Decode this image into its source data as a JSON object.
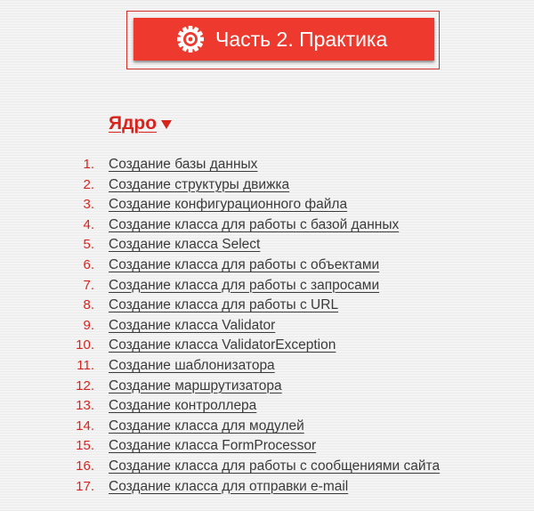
{
  "header": {
    "button_label": "Часть 2. Практика",
    "icon": "gear-icon",
    "colors": {
      "banner": "#ee3a2e",
      "accent": "#d8231c"
    }
  },
  "section": {
    "title": "Ядро",
    "toggle_icon": "triangle-down-icon"
  },
  "lessons": [
    {
      "number": "1.",
      "title": "Создание базы данных"
    },
    {
      "number": "2.",
      "title": "Создание структуры движка"
    },
    {
      "number": "3.",
      "title": "Создание конфигурационного файла"
    },
    {
      "number": "4.",
      "title": "Создание класса для работы с базой данных"
    },
    {
      "number": "5.",
      "title": "Создание класса Select"
    },
    {
      "number": "6.",
      "title": "Создание класса для работы с объектами"
    },
    {
      "number": "7.",
      "title": "Создание класса для работы с запросами"
    },
    {
      "number": "8.",
      "title": "Создание класса для работы с URL"
    },
    {
      "number": "9.",
      "title": "Создание класса Validator"
    },
    {
      "number": "10.",
      "title": "Создание класса ValidatorException"
    },
    {
      "number": "11.",
      "title": "Создание шаблонизатора"
    },
    {
      "number": "12.",
      "title": "Создание маршрутизатора"
    },
    {
      "number": "13.",
      "title": "Создание контроллера"
    },
    {
      "number": "14.",
      "title": "Создание класса для модулей"
    },
    {
      "number": "15.",
      "title": "Создание класса FormProcessor"
    },
    {
      "number": "16.",
      "title": "Создание класса для работы с сообщениями сайта"
    },
    {
      "number": "17.",
      "title": "Создание класса для отправки e-mail"
    }
  ]
}
